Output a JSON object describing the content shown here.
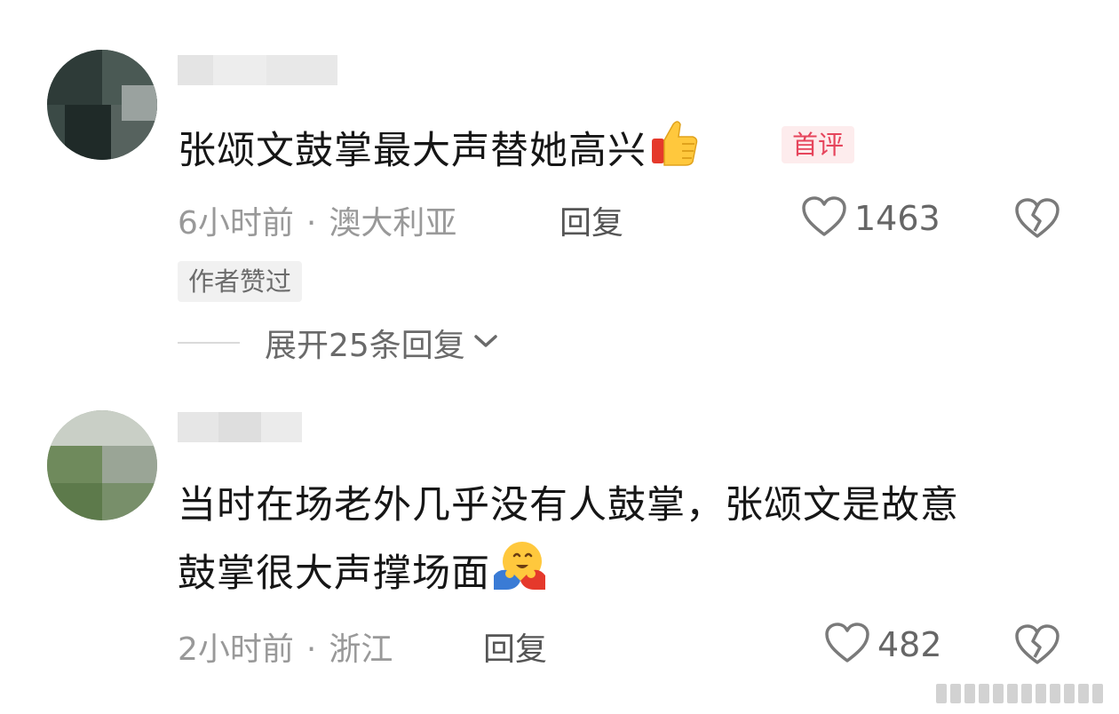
{
  "comments": [
    {
      "text": "张颂文鼓掌最大声替她高兴",
      "emoji": "thumbs-up",
      "first_badge": "首评",
      "time": "6小时前",
      "location": "澳大利亚",
      "reply_label": "回复",
      "likes": "1463",
      "author_badge": "作者赞过",
      "expand_label": "展开25条回复"
    },
    {
      "text_line1": "当时在场老外几乎没有人鼓掌，张颂文是故意",
      "text_line2": "鼓掌很大声撑场面",
      "emoji": "hugging-face",
      "time": "2小时前",
      "location": "浙江",
      "reply_label": "回复",
      "likes": "482"
    }
  ],
  "icons": {
    "like": "heart-outline-icon",
    "dislike": "broken-heart-icon",
    "expand": "chevron-down-icon"
  },
  "colors": {
    "first_badge_bg": "#fdeced",
    "first_badge_text": "#e6455c",
    "meta_text": "#999999"
  }
}
